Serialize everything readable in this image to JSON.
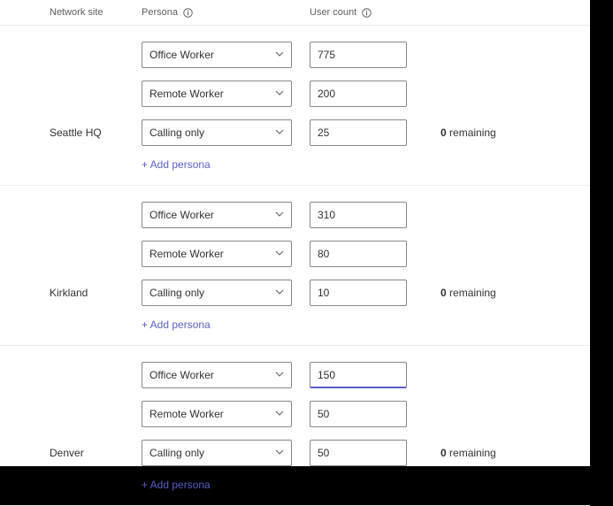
{
  "headers": {
    "site": "Network site",
    "persona": "Persona",
    "count": "User count"
  },
  "add_persona_label": "+ Add persona",
  "remaining_label": "remaining",
  "sites": [
    {
      "name": "Seattle HQ",
      "remaining": "0",
      "rows": [
        {
          "persona": "Office Worker",
          "count": "775"
        },
        {
          "persona": "Remote Worker",
          "count": "200"
        },
        {
          "persona": "Calling only",
          "count": "25"
        }
      ]
    },
    {
      "name": "Kirkland",
      "remaining": "0",
      "rows": [
        {
          "persona": "Office Worker",
          "count": "310"
        },
        {
          "persona": "Remote Worker",
          "count": "80"
        },
        {
          "persona": "Calling only",
          "count": "10"
        }
      ]
    },
    {
      "name": "Denver",
      "remaining": "0",
      "rows": [
        {
          "persona": "Office Worker",
          "count": "150",
          "focused": true
        },
        {
          "persona": "Remote Worker",
          "count": "50"
        },
        {
          "persona": "Calling only",
          "count": "50"
        }
      ]
    }
  ]
}
